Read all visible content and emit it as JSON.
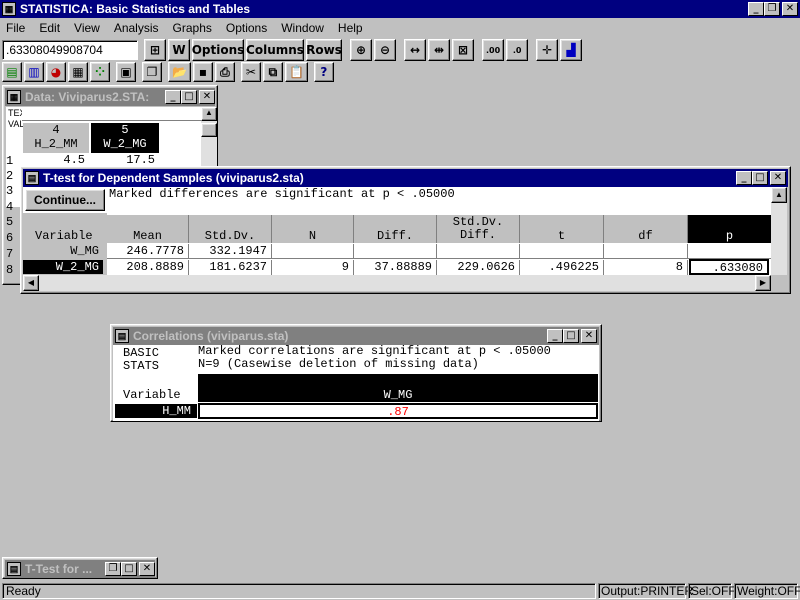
{
  "app": {
    "title": "STATISTICA: Basic Statistics and Tables"
  },
  "menubar": {
    "items": [
      "File",
      "Edit",
      "View",
      "Analysis",
      "Graphs",
      "Options",
      "Window",
      "Help"
    ]
  },
  "toolbar": {
    "value_field": ".63308049908704",
    "options_label": "Options",
    "columns_label": "Columns",
    "rows_label": "Rows"
  },
  "data_window": {
    "title": "Data: Viviparus2.STA:",
    "corner_text": [
      "TEX",
      "VAL"
    ],
    "columns": [
      {
        "num": "4",
        "name": "H_2_MM"
      },
      {
        "num": "5",
        "name": "W_2_MG"
      }
    ],
    "row_numbers": [
      "1",
      "2",
      "3",
      "4",
      "5",
      "6",
      "7",
      "8"
    ],
    "row1": [
      "4.5",
      "17.5"
    ]
  },
  "ttest_window": {
    "title": "T-test for Dependent Samples (viviparus2.sta)",
    "continue_label": "Continue...",
    "message": "Marked differences are significant at p < .05000",
    "variable_header": "Variable",
    "columns": [
      "Mean",
      "Std.Dv.",
      "N",
      "Diff.",
      "Std.Dv.",
      "t",
      "df",
      "p"
    ],
    "std_dv_diff_subheader": "Diff.",
    "rows": [
      {
        "variable": "W_MG",
        "values": [
          "246.7778",
          "332.1947",
          "",
          "",
          "",
          "",
          "",
          ""
        ]
      },
      {
        "variable": "W_2_MG",
        "values": [
          "208.8889",
          "181.6237",
          "9",
          "37.88889",
          "229.0626",
          ".496225",
          "8",
          ".633080"
        ]
      }
    ]
  },
  "corr_window": {
    "title": "Correlations (viviparus.sta)",
    "basic_stats": [
      "BASIC",
      "STATS"
    ],
    "message_line1": "Marked correlations are significant at p < .05000",
    "message_line2": "N=9 (Casewise deletion of missing data)",
    "variable_header": "Variable",
    "column": "W_MG",
    "row_label": "H_MM",
    "value": ".87",
    "value_color": "#ff0000"
  },
  "minimized_window": {
    "title": "T-Test for ..."
  },
  "statusbar": {
    "status": "Ready",
    "output": "Output:PRINTER",
    "sel": "Sel:OFF",
    "weight": "Weight:OFF"
  },
  "colors": {
    "titlebar_active": "#000080",
    "desktop": "#c0c0c0",
    "selection": "#000000"
  }
}
